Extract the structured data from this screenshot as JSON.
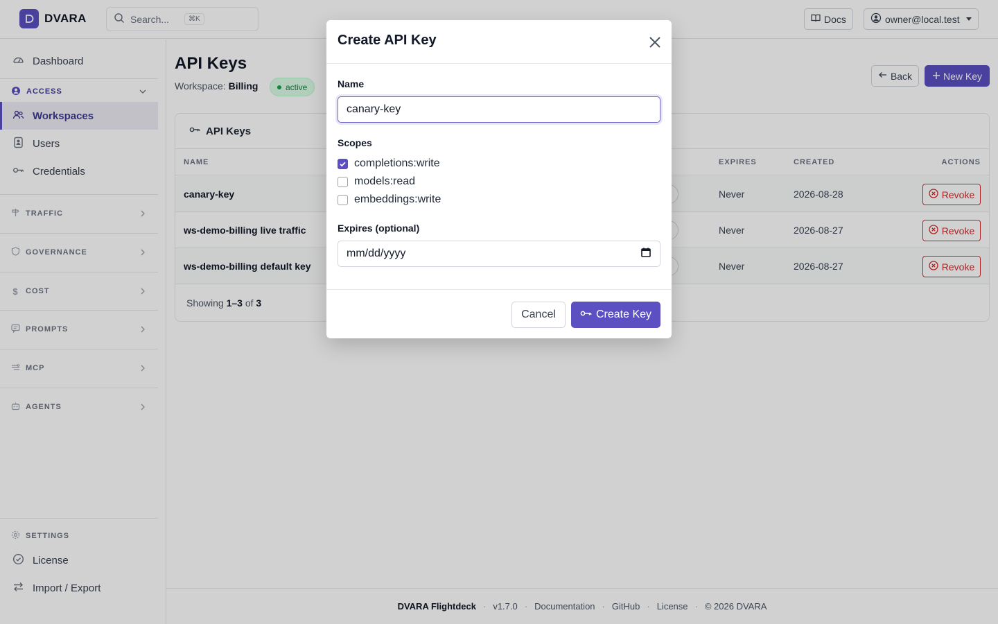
{
  "app": {
    "brand": "DVARA"
  },
  "topbar": {
    "search_placeholder": "Search...",
    "search_shortcut": "⌘K",
    "docs_label": "Docs",
    "user_label": "owner@local.test"
  },
  "sidebar": {
    "dashboard": "Dashboard",
    "access_section": "ACCESS",
    "workspaces": "Workspaces",
    "users": "Users",
    "credentials": "Credentials",
    "traffic_section": "TRAFFIC",
    "governance_section": "GOVERNANCE",
    "cost_section": "COST",
    "prompts_section": "PROMPTS",
    "mcp_section": "MCP",
    "agents_section": "AGENTS",
    "settings_section": "SETTINGS",
    "license": "License",
    "import_export": "Import / Export"
  },
  "page": {
    "title": "API Keys",
    "workspace_prefix": "Workspace:",
    "workspace_name": "Billing",
    "status_badge": "active",
    "back_label": "Back",
    "new_key_label": "New Key"
  },
  "table": {
    "card_title": "API Keys",
    "columns": {
      "name": "NAME",
      "expires": "EXPIRES",
      "created": "CREATED",
      "actions": "ACTIONS"
    },
    "rows": [
      {
        "name": "canary-key",
        "expires": "Never",
        "created": "2026-08-28",
        "action": "Revoke"
      },
      {
        "name": "ws-demo-billing live traffic",
        "expires": "Never",
        "created": "2026-08-27",
        "action": "Revoke"
      },
      {
        "name": "ws-demo-billing default key",
        "expires": "Never",
        "created": "2026-08-27",
        "action": "Revoke"
      }
    ],
    "showing_prefix": "Showing",
    "showing_range": "1–3",
    "showing_of": "of",
    "showing_total": "3"
  },
  "footer": {
    "brand": "DVARA Flightdeck",
    "version": "v1.7.0",
    "documentation": "Documentation",
    "github": "GitHub",
    "license": "License",
    "copyright": "© 2026 DVARA"
  },
  "modal": {
    "title": "Create API Key",
    "name_label": "Name",
    "name_value": "canary-key",
    "scopes_label": "Scopes",
    "scopes": [
      {
        "label": "completions:write",
        "checked": true
      },
      {
        "label": "models:read",
        "checked": false
      },
      {
        "label": "embeddings:write",
        "checked": false
      }
    ],
    "expires_label": "Expires (optional)",
    "expires_placeholder": "mm/dd/yyyy",
    "cancel_label": "Cancel",
    "create_label": "Create Key"
  },
  "colors": {
    "accent": "#5b4fc1",
    "danger": "#dc2626",
    "success": "#15803d"
  }
}
